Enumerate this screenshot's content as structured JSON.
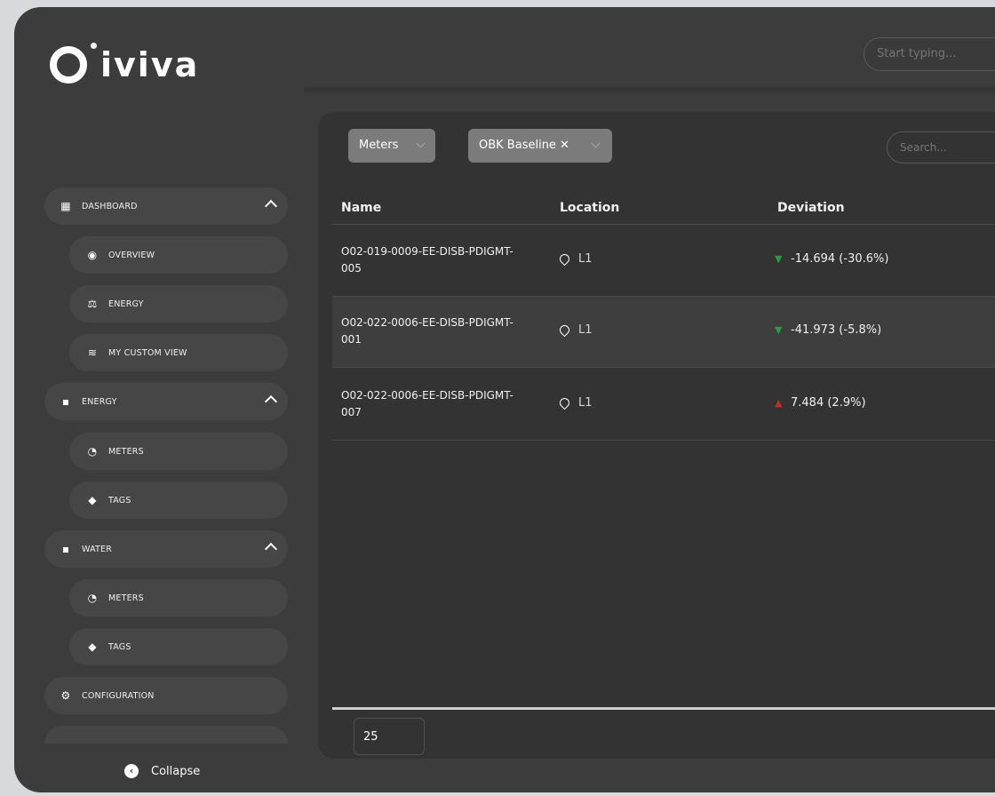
{
  "app": {
    "logo_text": "iviva"
  },
  "header": {
    "search_placeholder": "Start typing..."
  },
  "sidebar": {
    "items": [
      {
        "label": "DASHBOARD",
        "icon": "grid-icon",
        "expanded": true
      },
      {
        "label": "OVERVIEW",
        "icon": "eye-icon"
      },
      {
        "label": "ENERGY",
        "icon": "scales-icon"
      },
      {
        "label": "MY CUSTOM VIEW",
        "icon": "layers-icon"
      },
      {
        "label": "ENERGY",
        "icon": "plug-icon",
        "expanded": true
      },
      {
        "label": "METERS",
        "icon": "gauge-icon"
      },
      {
        "label": "TAGS",
        "icon": "tag-icon"
      },
      {
        "label": "WATER",
        "icon": "plug-icon",
        "expanded": true
      },
      {
        "label": "METERS",
        "icon": "gauge-icon"
      },
      {
        "label": "TAGS",
        "icon": "tag-icon"
      },
      {
        "label": "CONFIGURATION",
        "icon": "gear-icon"
      }
    ],
    "collapse_label": "Collapse"
  },
  "filters": {
    "type_label": "Meters",
    "baseline_label": "OBK Baseline",
    "search_placeholder": "Search..."
  },
  "table": {
    "columns": [
      "Name",
      "Location",
      "Deviation"
    ],
    "rows": [
      {
        "name": "O02-019-0009-EE-DISB-PDIGMT-005",
        "location": "L1",
        "deviation": "-14.694  (-30.6%)",
        "trend": "down"
      },
      {
        "name": "O02-022-0006-EE-DISB-PDIGMT-001",
        "location": "L1",
        "deviation": "-41.973  (-5.8%)",
        "trend": "down"
      },
      {
        "name": "O02-022-0006-EE-DISB-PDIGMT-007",
        "location": "L1",
        "deviation": "7.484  (2.9%)",
        "trend": "up"
      }
    ]
  },
  "pagination": {
    "page_size": "25"
  },
  "colors": {
    "down": "#2e9a3f",
    "up": "#d02828",
    "panel": "#333333",
    "sidebar_item": "#464646"
  }
}
